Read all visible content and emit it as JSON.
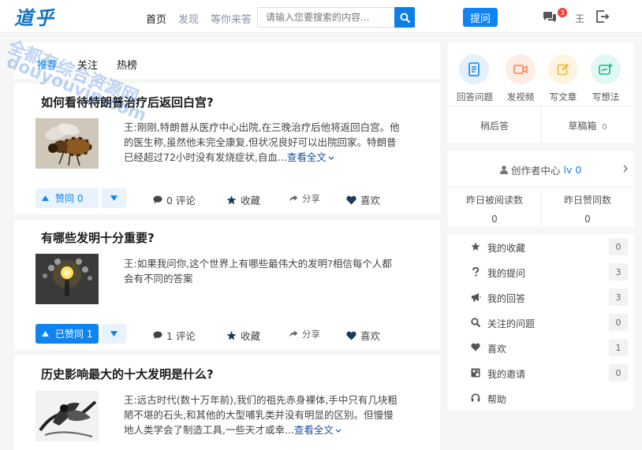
{
  "header": {
    "logo": "道乎",
    "nav": [
      "首页",
      "发现",
      "等你来答"
    ],
    "search_placeholder": "请输入您要搜索的内容...",
    "ask_label": "提问",
    "notification_count": "3",
    "user_name": "王",
    "brand_color": "#0e84f0"
  },
  "watermark": {
    "line1": "全都有综合资源网",
    "line2": "douyouvip.com"
  },
  "feed": {
    "tabs": [
      "推荐",
      "关注",
      "热榜"
    ],
    "questions": [
      {
        "title": "如何看待特朗普治疗后返回白宫?",
        "image": "bee-photo",
        "excerpt": "王:刚刚,特朗普从医疗中心出院,在三晚治疗后他将返回白宫。他的医生称,虽然他未完全康复,但状况良好可以出院回家。特朗普已经超过72小时没有发烧症状,自血...",
        "more": "查看全文",
        "vote_label": "赞同 0",
        "vote_style": "light",
        "comments": "0 评论",
        "collect": "收藏",
        "share": "分享",
        "like": "喜欢"
      },
      {
        "title": "有哪些发明十分重要?",
        "image": "lightbulb-photo",
        "excerpt": "王:如果我问你,这个世界上有哪些最伟大的发明?相信每个人都会有不同的答案",
        "more": "",
        "vote_label": "已赞同 1",
        "vote_style": "solid",
        "comments": "1 评论",
        "collect": "收藏",
        "share": "分享",
        "like": "喜欢"
      },
      {
        "title": "历史影响最大的十大发明是什么?",
        "image": "ink-painting",
        "excerpt": "王:远古时代(数十万年前),我们的祖先赤身裸体,手中只有几块粗陋不堪的石头,和其他的大型哺乳类并没有明显的区别。但慢慢地人类学会了制造工具,一些天才或幸...",
        "more": "查看全文"
      }
    ]
  },
  "sidebar": {
    "create": [
      {
        "label": "回答问题",
        "icon": "answer-doc-icon",
        "bg": "#e4f0fd",
        "color": "#0e84f0"
      },
      {
        "label": "发视频",
        "icon": "video-camera-icon",
        "bg": "#fdece3",
        "color": "#f08a4b"
      },
      {
        "label": "写文章",
        "icon": "edit-pen-icon",
        "bg": "#fdf5df",
        "color": "#f0b93a"
      },
      {
        "label": "写想法",
        "icon": "idea-chat-icon",
        "bg": "#e2f7f3",
        "color": "#1ab394"
      }
    ],
    "drafts": {
      "later": "稍后答",
      "drafts_label": "草稿箱",
      "drafts_count": "0"
    },
    "creator": {
      "label": "创作者中心",
      "level": "lv 0"
    },
    "stats": [
      {
        "label": "昨日被阅读数",
        "value": "0"
      },
      {
        "label": "昨日赞同数",
        "value": "0"
      }
    ],
    "menu": [
      {
        "label": "我的收藏",
        "icon": "star-icon",
        "count": "0"
      },
      {
        "label": "我的提问",
        "icon": "question-mark-icon",
        "count": "3"
      },
      {
        "label": "我的回答",
        "icon": "megaphone-icon",
        "count": "3"
      },
      {
        "label": "关注的问题",
        "icon": "search-icon",
        "count": "0"
      },
      {
        "label": "喜欢",
        "icon": "heart-icon",
        "count": "1"
      },
      {
        "label": "我的邀请",
        "icon": "invite-icon",
        "count": "0"
      },
      {
        "label": "帮助",
        "icon": "headset-icon",
        "count": ""
      }
    ]
  }
}
